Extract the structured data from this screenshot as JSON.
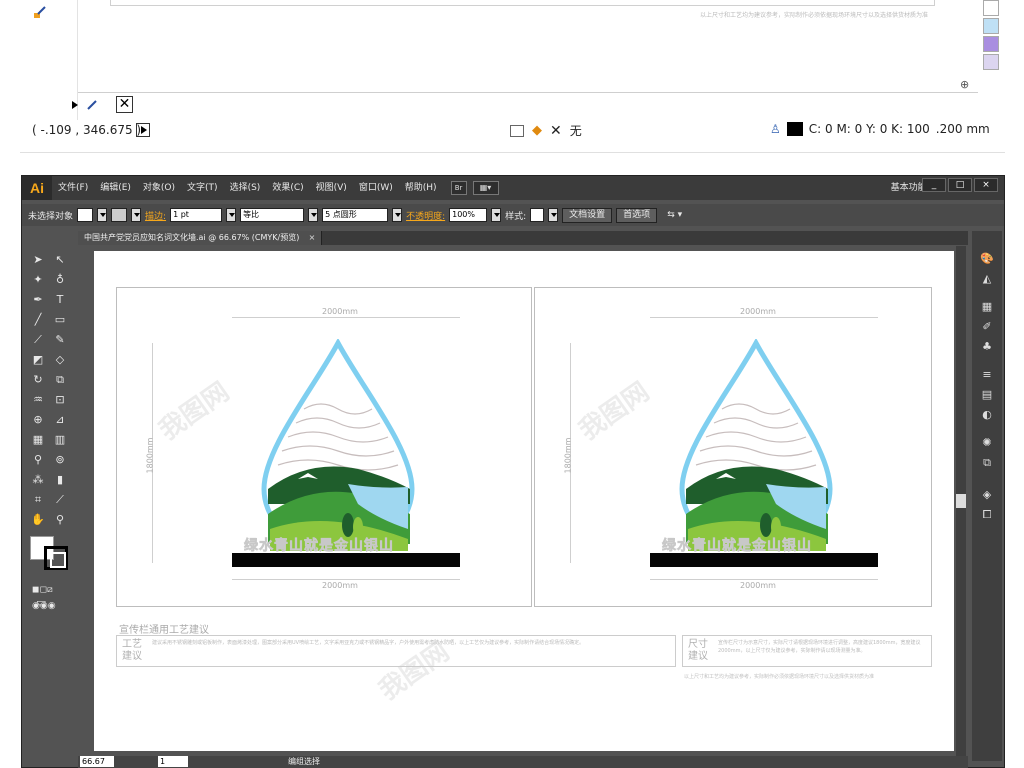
{
  "top_panel": {
    "coordinates": "( -.109 , 346.675 )",
    "fill_label": "无",
    "color_values": "C: 0 M: 0 Y: 0 K: 100",
    "stroke_size": ".200 mm",
    "swatch_colors": [
      "#ffffff",
      "#bfe0f5",
      "#a98ee0",
      "#dcd5f0"
    ]
  },
  "app": {
    "logo": "Ai",
    "menus": [
      "文件(F)",
      "编辑(E)",
      "对象(O)",
      "文字(T)",
      "选择(S)",
      "效果(C)",
      "视图(V)",
      "窗口(W)",
      "帮助(H)"
    ],
    "bridge_label": "Br",
    "workspace": "基本功能",
    "window_controls": [
      "_",
      "□",
      "×"
    ]
  },
  "control_bar": {
    "selection": "未选择对象",
    "stroke_label": "描边:",
    "stroke_value": "1 pt",
    "stroke_style": "等比",
    "brush": "5 点圆形",
    "opacity_label": "不透明度:",
    "opacity_value": "100%",
    "style_label": "样式:",
    "doc_setup": "文档设置",
    "preferences": "首选项"
  },
  "document": {
    "tab_title": "中国共产党党员应知名词文化墙.ai @ 66.67% (CMYK/预览)",
    "close": "×"
  },
  "artwork": {
    "width_dim": "2000mm",
    "height_dim": "1800mm",
    "slogan": "绿水青山就是金山银山",
    "process_heading": "宣传栏通用工艺建议",
    "craft_label_1": "工艺",
    "craft_label_2": "建议",
    "size_label_1": "尺寸",
    "size_label_2": "建议",
    "craft_body": "建议采用不锈钢雕刻或铝板制作，表面烤漆处理，图案部分采用UV喷绘工艺，文字采用亚克力或不锈钢精品字，户外使用需考虑防水防晒，以上工艺仅为建议参考，实际制作请结合现场情况确定。",
    "size_body": "宣传栏尺寸为示意尺寸，实际尺寸请根据现场环境进行调整，高度建议1800mm，宽度建议2000mm，以上尺寸仅为建议参考，实际制作请以现场测量为准。",
    "footnote": "以上尺寸和工艺均为建议参考，实际制作必须依据现场环境尺寸以及选择供货材质为准"
  },
  "status": {
    "zoom": "66.67",
    "page": "1",
    "mode": "编组选择"
  },
  "colors": {
    "drop_outline": "#7fcff0",
    "dark_green": "#1f5e2c",
    "mid_green": "#3f9c3a",
    "light_green": "#8cc63e",
    "river": "#9fd7f0"
  }
}
